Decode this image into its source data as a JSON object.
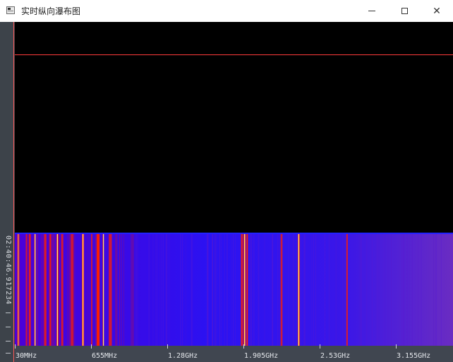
{
  "window": {
    "title": "实时纵向瀑布图",
    "icon": "app-window-icon",
    "controls": [
      "minimize-icon",
      "maximize-icon",
      "close-icon"
    ],
    "close_glyph": "✕"
  },
  "waterfall": {
    "timestamp": "02:40:46.917234",
    "frequency_labels": [
      "30MHz",
      "655MHz",
      "1.28GHz",
      "1.905GHz",
      "2.53GHz",
      "3.155GHz"
    ],
    "colors": {
      "background": "#000000",
      "baseline": "#1f1fff",
      "marker": "#ff3b3b",
      "hot": "#ff1e00",
      "peak": "#fff07a"
    },
    "strong_signal_frequencies_mhz": [
      50,
      120,
      145,
      190,
      270,
      315,
      370,
      410,
      490,
      580,
      655,
      700,
      750,
      800,
      1885,
      1905,
      1930,
      2210,
      2350,
      2750
    ]
  }
}
